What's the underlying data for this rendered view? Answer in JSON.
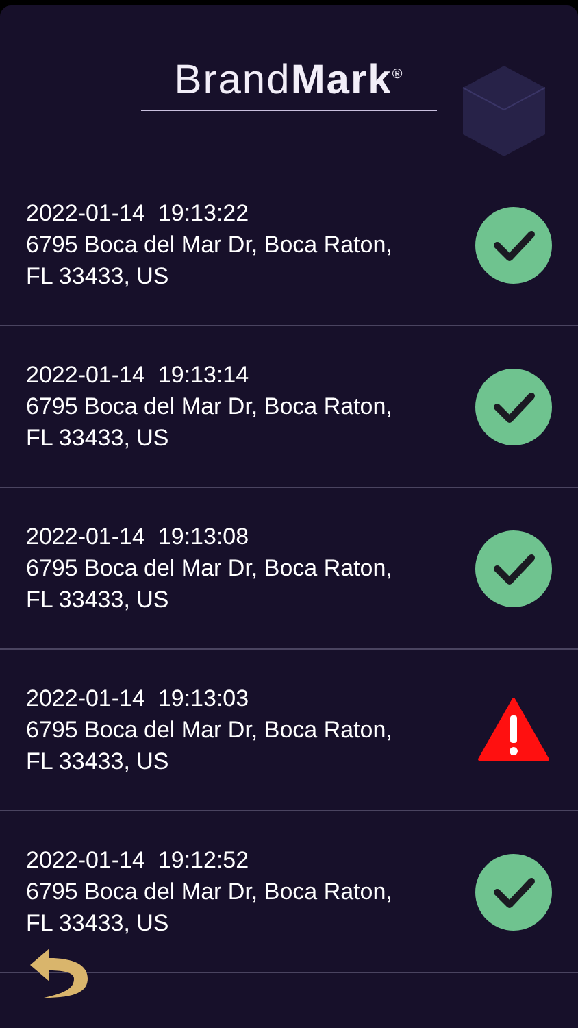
{
  "logo": {
    "text": "Brand**Mark**$^{®}$"
  },
  "entries": [
    {
      "timestamp": "2022-01-14  19:13:22",
      "address": "6795 Boca del Mar Dr, Boca Raton, FL 33433, US",
      "kind": "ok"
    },
    {
      "timestamp": "2022-01-14  19:13:14",
      "address": "6795 Boca del Mar Dr, Boca Raton, FL 33433, US",
      "kind": "ok"
    },
    {
      "timestamp": "2022-01-14  19:13:08",
      "address": "6795 Boca del Mar Dr, Boca Raton, FL 33433, US",
      "kind": "ok"
    },
    {
      "timestamp": "2022-01-14  19:13:03",
      "address": "6795 Boca del Mar Dr, Boca Raton, FL 33433, US",
      "kind": "warning"
    },
    {
      "timestamp": "2022-01-14  19:12:52",
      "address": "6795 Boca del Mar Dr, Boca Raton, FL 33433, US",
      "kind": "ok"
    }
  ]
}
